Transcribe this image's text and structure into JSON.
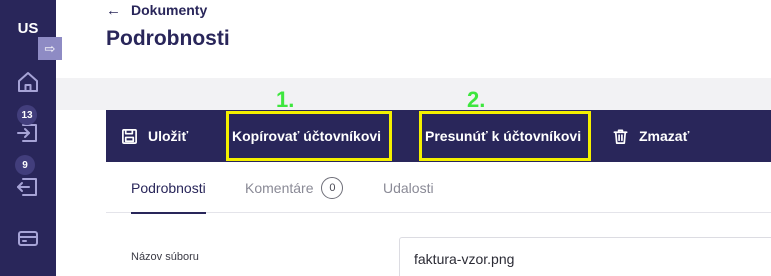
{
  "sidebar": {
    "avatar_initials": "US",
    "collapse_icon": "collapse-arrow-icon",
    "items": [
      {
        "icon": "home-icon"
      },
      {
        "icon": "inbox-in-icon",
        "badge": "13"
      },
      {
        "icon": "inbox-out-icon",
        "badge": "9"
      },
      {
        "icon": "card-icon"
      }
    ]
  },
  "header": {
    "back_label": "Dokumenty",
    "back_icon": "←",
    "title": "Podrobnosti"
  },
  "annotations": {
    "first": "1.",
    "second": "2.",
    "color": "#3ee63e",
    "highlight_color": "#f4f000"
  },
  "toolbar": {
    "save_label": "Uložiť",
    "copy_label": "Kopírovať účtovníkovi",
    "move_label": "Presunúť k účtovníkovi",
    "delete_label": "Zmazať"
  },
  "tabs": [
    {
      "label": "Podrobnosti",
      "active": true
    },
    {
      "label": "Komentáre",
      "count": "0"
    },
    {
      "label": "Udalosti"
    }
  ],
  "form": {
    "filename_label": "Názov súboru",
    "filename_value": "faktura-vzor.png"
  },
  "colors": {
    "brand": "#29265a",
    "accent": "#8e8bc4"
  }
}
